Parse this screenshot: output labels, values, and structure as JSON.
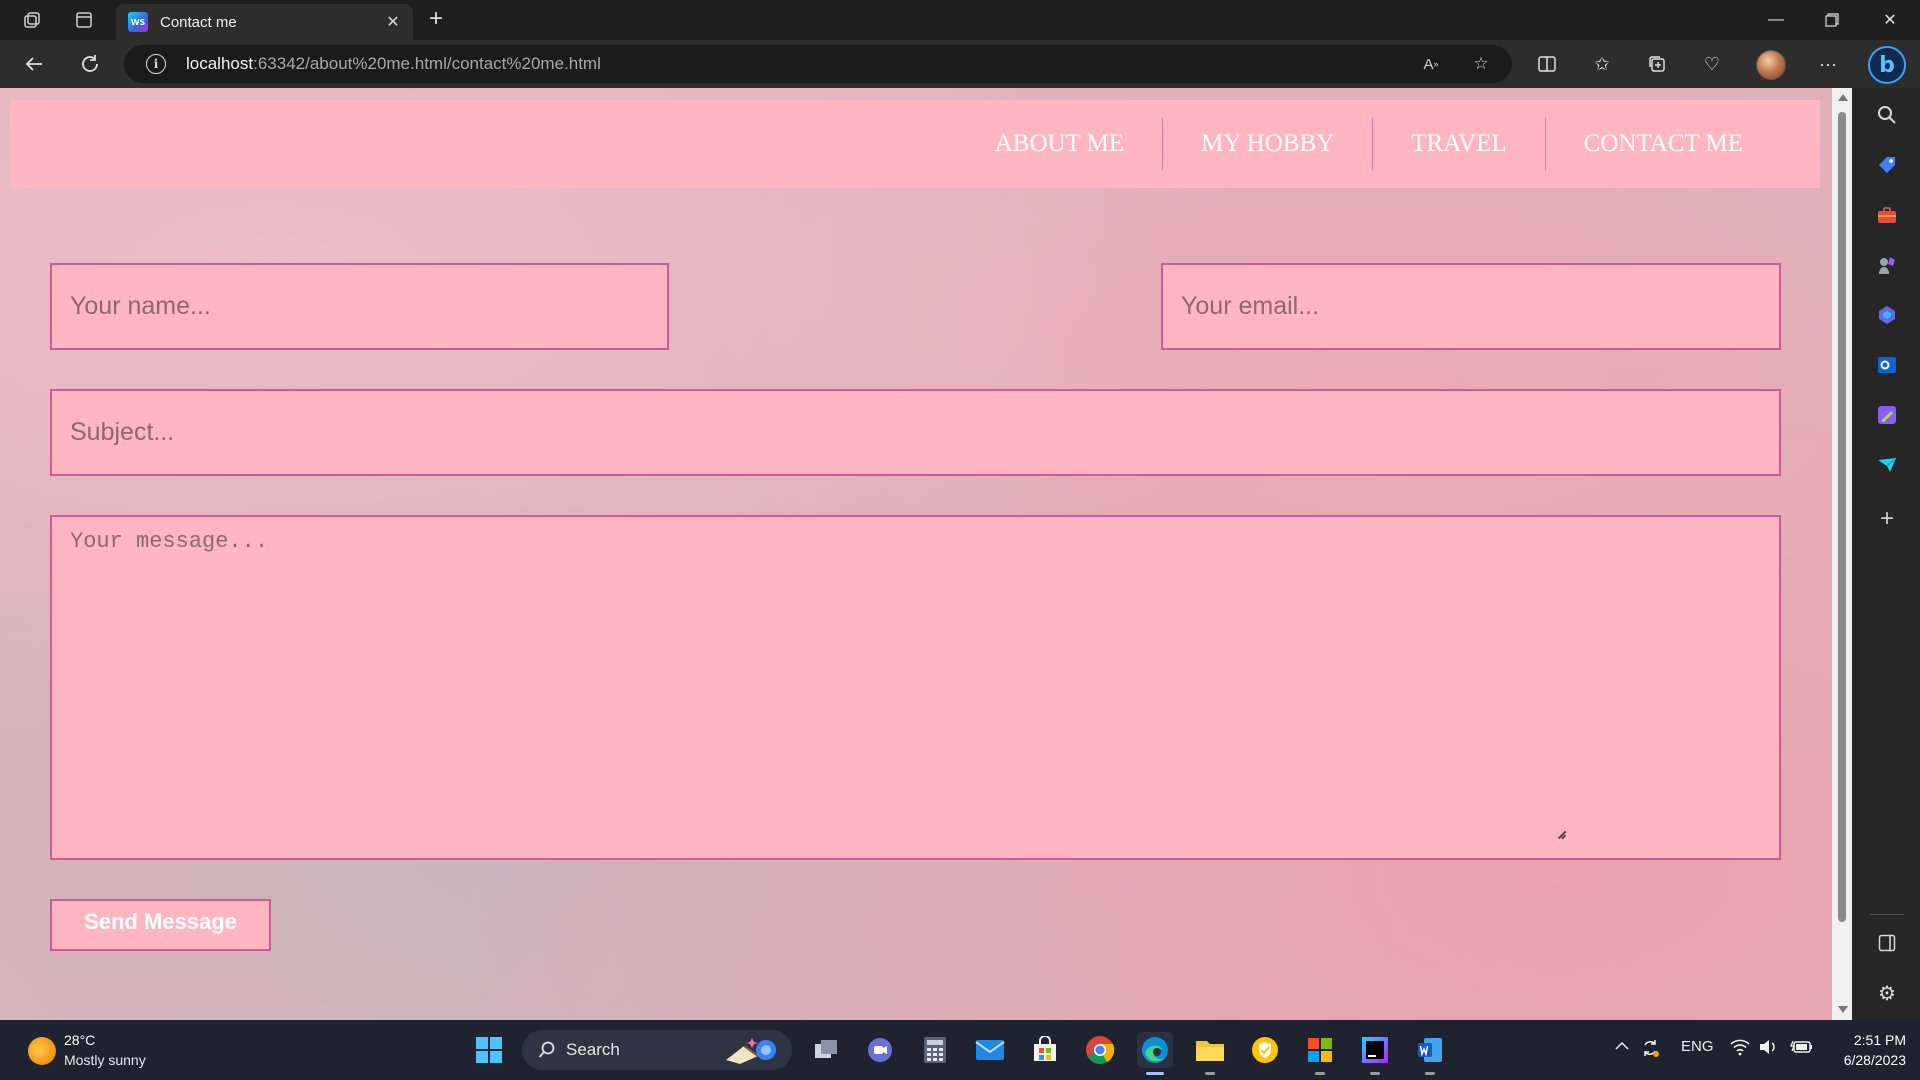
{
  "browser": {
    "tab": {
      "title": "Contact me"
    },
    "address": {
      "host": "localhost",
      "rest": ":63342/about%20me.html/contact%20me.html"
    }
  },
  "page": {
    "nav": [
      "ABOUT ME",
      "MY HOBBY",
      "TRAVEL",
      "CONTACT ME"
    ],
    "form": {
      "name_placeholder": "Your name...",
      "email_placeholder": "Your email...",
      "subject_placeholder": "Subject...",
      "message_placeholder": "Your message...",
      "send_label": "Send Message"
    },
    "colors": {
      "nav_bg": "#ffb6c1",
      "field_border": "#d05a98",
      "field_bg": "#ffb6c1"
    }
  },
  "taskbar": {
    "weather": {
      "temp": "28°C",
      "desc": "Mostly sunny"
    },
    "search_label": "Search",
    "tray": {
      "language": "ENG",
      "time": "2:51 PM",
      "date": "6/28/2023"
    }
  }
}
